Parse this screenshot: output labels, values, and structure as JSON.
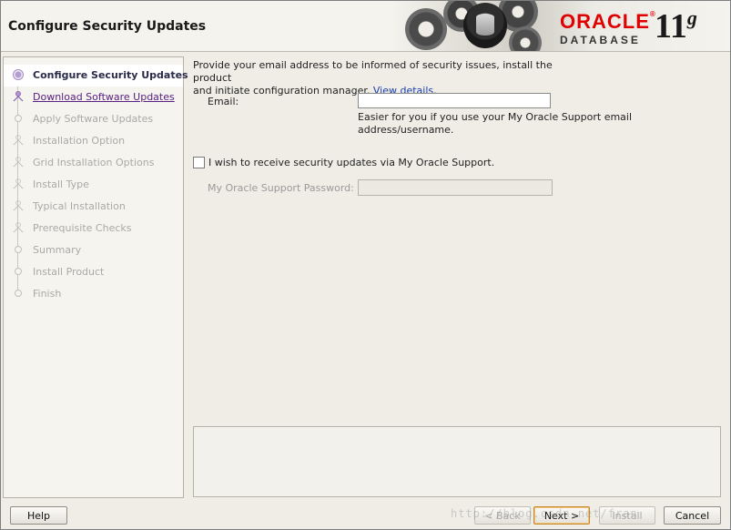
{
  "header": {
    "title": "Configure Security Updates",
    "brand": "ORACLE",
    "brand_reg": "®",
    "product": "DATABASE",
    "version": "11",
    "version_suffix": "g"
  },
  "steps": [
    {
      "label": "Configure Security Updates",
      "state": "active"
    },
    {
      "label": "Download Software Updates",
      "state": "link"
    },
    {
      "label": "Apply Software Updates",
      "state": "disabled"
    },
    {
      "label": "Installation Option",
      "state": "disabled"
    },
    {
      "label": "Grid Installation Options",
      "state": "disabled"
    },
    {
      "label": "Install Type",
      "state": "disabled"
    },
    {
      "label": "Typical Installation",
      "state": "disabled"
    },
    {
      "label": "Prerequisite Checks",
      "state": "disabled"
    },
    {
      "label": "Summary",
      "state": "disabled"
    },
    {
      "label": "Install Product",
      "state": "disabled"
    },
    {
      "label": "Finish",
      "state": "disabled"
    }
  ],
  "content": {
    "intro_line1": "Provide your email address to be informed of security issues, install the product",
    "intro_line2": "and initiate configuration manager.",
    "view_details": "View details",
    "intro_end": ".",
    "email_label": "Email:",
    "email_value": "",
    "email_hint": "Easier for you if you use your My Oracle Support email address/username.",
    "checkbox_label": "I wish to receive security updates via My Oracle Support.",
    "checkbox_checked": false,
    "password_label": "My Oracle Support Password:",
    "password_value": ""
  },
  "buttons": {
    "help": "Help",
    "back": "< Back",
    "next": "Next >",
    "install": "Install",
    "cancel": "Cancel"
  },
  "watermark": "http://blog.csdn.net/fran"
}
